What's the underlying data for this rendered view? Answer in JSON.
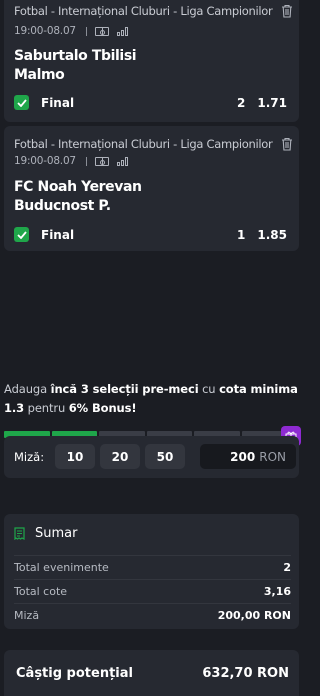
{
  "bets": [
    {
      "league": "Fotbal - Internațional Cluburi - Liga Campionilor",
      "datetime": "19:00-08.07",
      "home": "Saburtalo Tbilisi",
      "away": "Malmo",
      "market": "Final",
      "pick": "2",
      "odds": "1.71"
    },
    {
      "league": "Fotbal - Internațional Cluburi - Liga Campionilor",
      "datetime": "19:00-08.07",
      "home": "FC Noah Yerevan",
      "away": "Buducnost P.",
      "market": "Final",
      "pick": "1",
      "odds": "1.85"
    }
  ],
  "promo": {
    "p1": "Adauga ",
    "b1": "încă 3 selecții pre-meci",
    "p2": " cu ",
    "b2": "cota minima 1.3",
    "p3": " pentru ",
    "b3": "6% Bonus!",
    "progress_filled_segments": 2,
    "progress_total_segments": 6
  },
  "stake": {
    "label": "Miză:",
    "quick": [
      "10",
      "20",
      "50"
    ],
    "amount": "200",
    "currency": "RON"
  },
  "summary": {
    "title": "Sumar",
    "rows": [
      {
        "label": "Total evenimente",
        "value": "2"
      },
      {
        "label": "Total cote",
        "value": "3,16"
      },
      {
        "label": "Miză",
        "value": "200,00 RON"
      }
    ]
  },
  "win": {
    "label": "Câștig potențial",
    "value": "632,70 RON"
  },
  "colors": {
    "accent_green": "#1fa64a",
    "bonus_purple": "#8e2ad2",
    "card_bg": "#262931",
    "page_bg": "#1b1d23"
  }
}
